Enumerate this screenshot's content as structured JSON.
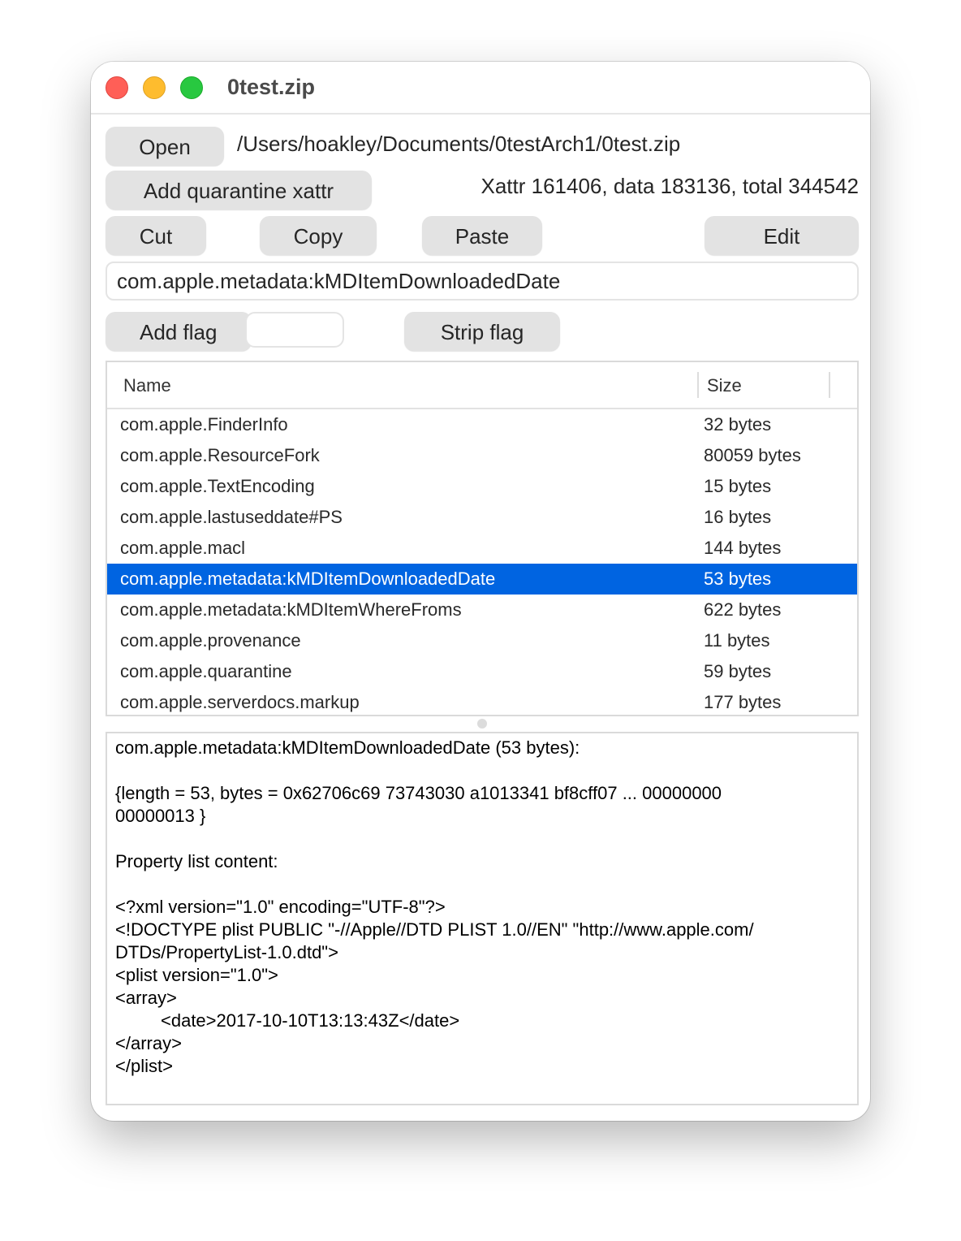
{
  "window": {
    "title": "0test.zip"
  },
  "toolbar": {
    "open_label": "Open",
    "file_path": "/Users/hoakley/Documents/0testArch1/0test.zip",
    "add_quarantine_label": "Add quarantine xattr",
    "totals_text": "Xattr 161406, data 183136, total 344542",
    "cut_label": "Cut",
    "copy_label": "Copy",
    "paste_label": "Paste",
    "edit_label": "Edit",
    "xattr_name_value": "com.apple.metadata:kMDItemDownloadedDate",
    "add_flag_label": "Add flag",
    "flag_value": "",
    "strip_flag_label": "Strip flag"
  },
  "table": {
    "columns": [
      "Name",
      "Size"
    ],
    "selected_index": 5,
    "rows": [
      {
        "name": "com.apple.FinderInfo",
        "size": "32 bytes"
      },
      {
        "name": "com.apple.ResourceFork",
        "size": "80059 bytes"
      },
      {
        "name": "com.apple.TextEncoding",
        "size": "15 bytes"
      },
      {
        "name": "com.apple.lastuseddate#PS",
        "size": "16 bytes"
      },
      {
        "name": "com.apple.macl",
        "size": "144 bytes"
      },
      {
        "name": "com.apple.metadata:kMDItemDownloadedDate",
        "size": "53 bytes"
      },
      {
        "name": "com.apple.metadata:kMDItemWhereFroms",
        "size": "622 bytes"
      },
      {
        "name": "com.apple.provenance",
        "size": "11 bytes"
      },
      {
        "name": "com.apple.quarantine",
        "size": "59 bytes"
      },
      {
        "name": "com.apple.serverdocs.markup",
        "size": "177 bytes"
      }
    ]
  },
  "detail": {
    "lines": [
      "com.apple.metadata:kMDItemDownloadedDate (53 bytes):",
      "",
      "{length = 53, bytes = 0x62706c69 73743030 a1013341 bf8cff07 ... 00000000",
      "00000013 }",
      "",
      "Property list content:",
      "",
      "<?xml version=\"1.0\" encoding=\"UTF-8\"?>",
      "<!DOCTYPE plist PUBLIC \"-//Apple//DTD PLIST 1.0//EN\" \"http://www.apple.com/",
      "DTDs/PropertyList-1.0.dtd\">",
      "<plist version=\"1.0\">",
      "<array>",
      "\t<date>2017-10-10T13:13:43Z</date>",
      "</array>",
      "</plist>"
    ]
  },
  "colors": {
    "selection": "#0064e1",
    "close": "#ff5f57",
    "minimize": "#febc2e",
    "maximize": "#28c840"
  }
}
